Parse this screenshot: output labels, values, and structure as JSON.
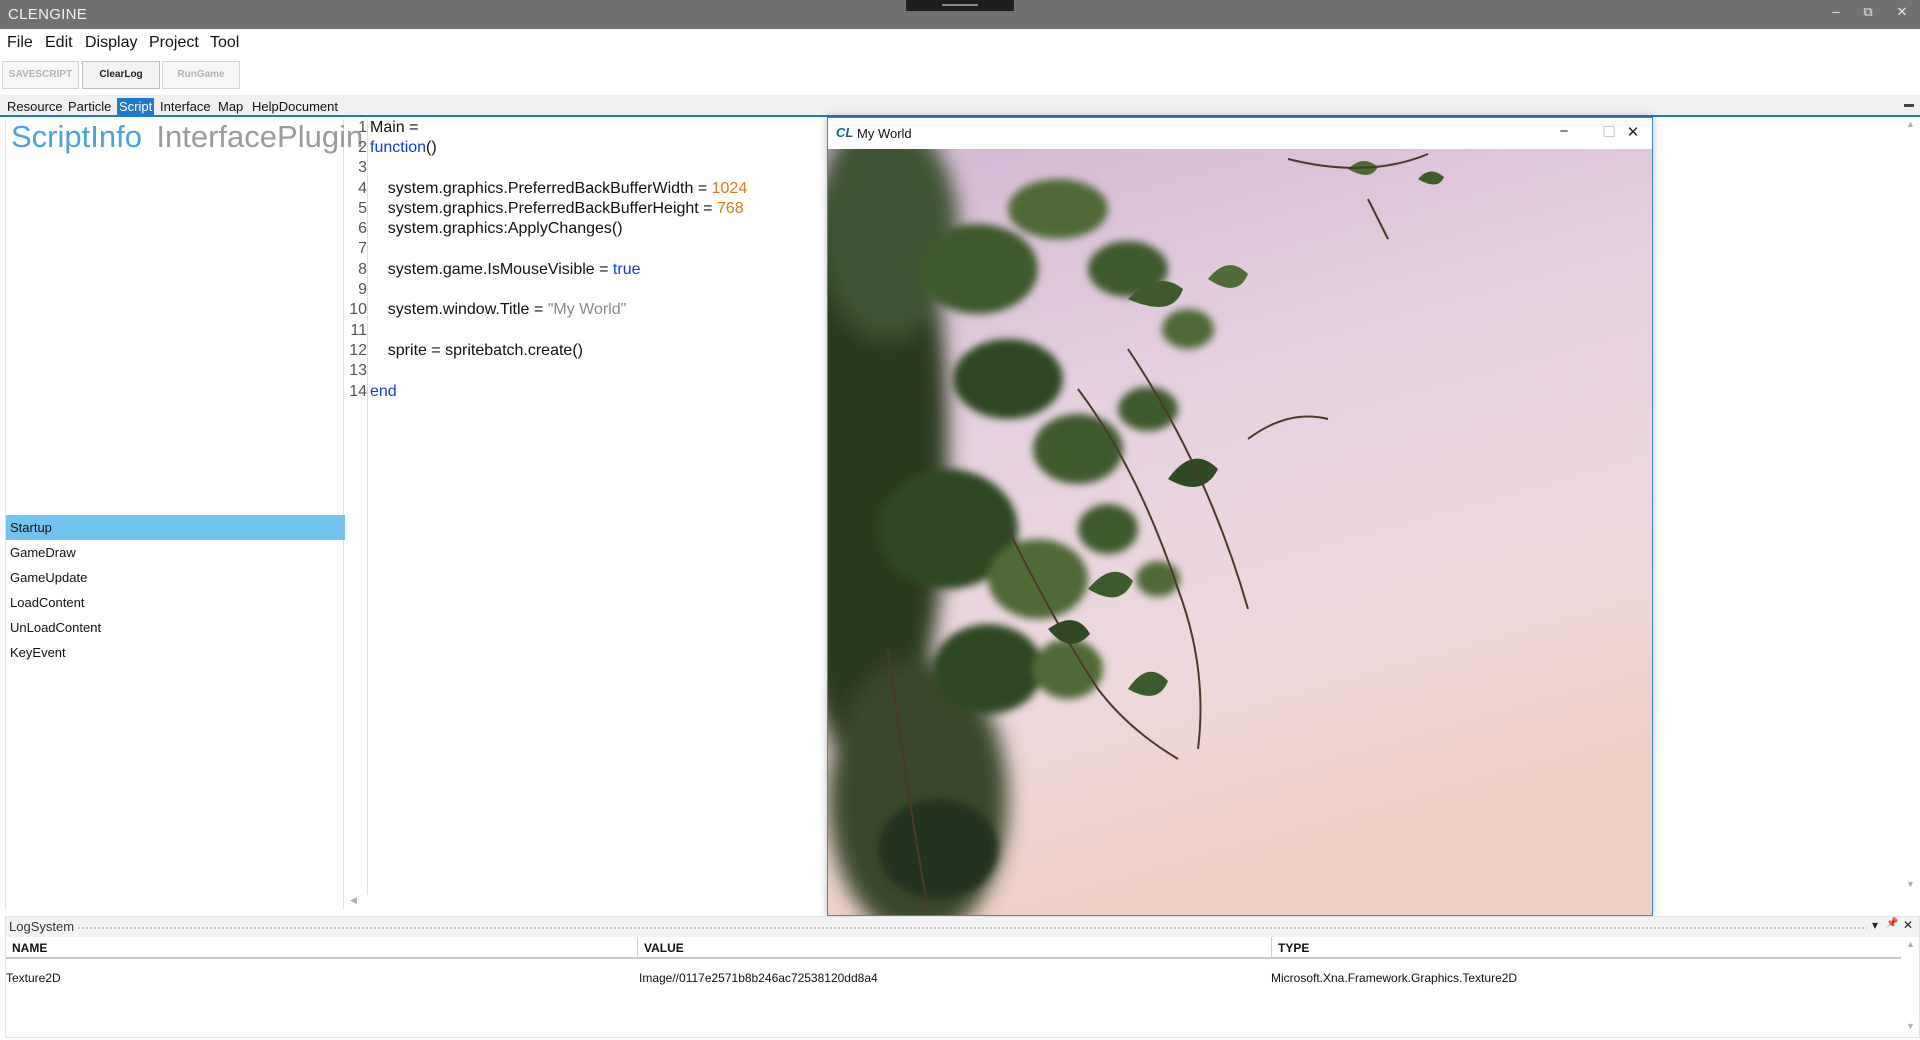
{
  "app": {
    "title": "CLENGINE"
  },
  "window_controls": {
    "minimize": "‒",
    "restore": "⧉",
    "close": "✕"
  },
  "menu": [
    "File",
    "Edit",
    "Display",
    "Project",
    "Tool"
  ],
  "toolbar": {
    "save_script": "SAVESCRIPT",
    "clear_log": "ClearLog",
    "run_game": "RunGame"
  },
  "tabs": [
    "Resource",
    "Particle",
    "Script",
    "Interface",
    "Map",
    "HelpDocument"
  ],
  "active_tab": "Script",
  "left_panel": {
    "headers": [
      "ScriptInfo",
      "InterfacePlugin"
    ],
    "events": [
      "Startup",
      "GameDraw",
      "GameUpdate",
      "LoadContent",
      "UnLoadContent",
      "KeyEvent"
    ],
    "selected_event": "Startup"
  },
  "editor": {
    "line_numbers": [
      "1",
      "2",
      "3",
      "4",
      "5",
      "6",
      "7",
      "8",
      "9",
      "10",
      "11",
      "12",
      "13",
      "14"
    ],
    "lines": {
      "l1": "Main =",
      "l2_kw": "function",
      "l2_rest": "()",
      "l4_text": "    system.graphics.PreferredBackBufferWidth = ",
      "l4_num": "1024",
      "l5_text": "    system.graphics.PreferredBackBufferHeight = ",
      "l5_num": "768",
      "l6": "    system.graphics:ApplyChanges()",
      "l8_text": "    system.game.IsMouseVisible = ",
      "l8_kw": "true",
      "l10_text": "    system.window.Title = ",
      "l10_str": "\"My World\"",
      "l12": "    sprite = spritebatch.create()",
      "l14_kw": "end"
    }
  },
  "game_window": {
    "logo": "CL",
    "title": "My World",
    "minimize": "−",
    "maximize": "☐",
    "close": "✕",
    "sky_colors": [
      "#d4b6d3",
      "#e7d1e1",
      "#efd8dc",
      "#f0cfc4"
    ],
    "leaf_colors": [
      "#3d5a2a",
      "#2f4a23",
      "#4f6a35",
      "#20301a"
    ]
  },
  "log": {
    "title": "LogSystem",
    "pin": "📌",
    "dropdown": "▾",
    "close": "✕",
    "columns": [
      "NAME",
      "VALUE",
      "TYPE"
    ],
    "rows": [
      {
        "name": "Texture2D",
        "value": "Image//0117e2571b8b246ac72538120dd8a4",
        "type": "Microsoft.Xna.Framework.Graphics.Texture2D"
      }
    ]
  },
  "strip_menu": "▬"
}
